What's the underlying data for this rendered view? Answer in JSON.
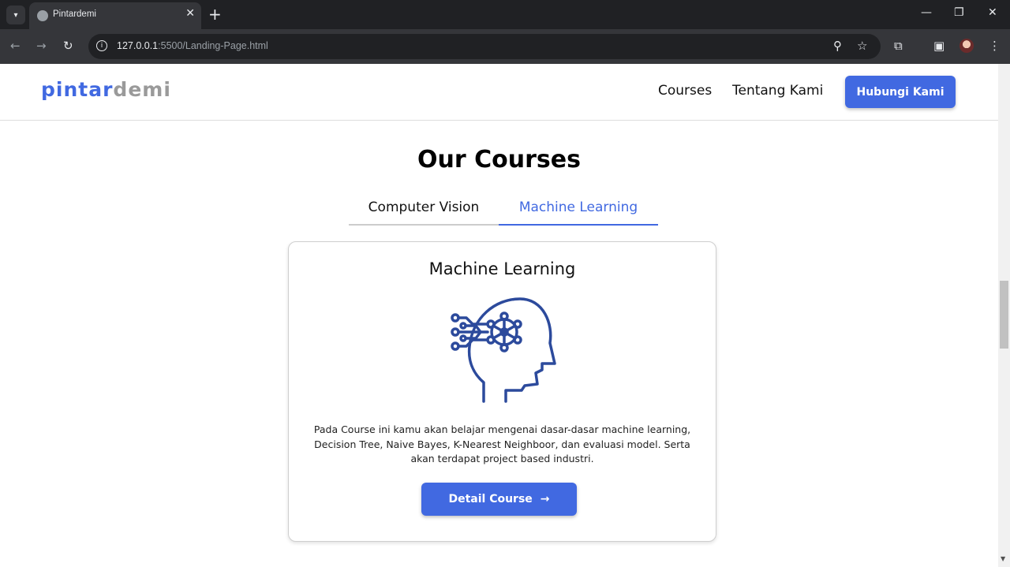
{
  "browser": {
    "tab_title": "Pintardemi",
    "url_host": "127.0.0.1",
    "url_rest": ":5500/Landing-Page.html"
  },
  "header": {
    "logo_part1": "pintar",
    "logo_part2": "demi",
    "nav": [
      "Courses",
      "Tentang Kami"
    ],
    "cta": "Hubungi Kami"
  },
  "courses": {
    "title": "Our Courses",
    "tabs": [
      "Computer Vision",
      "Machine Learning"
    ],
    "active_tab": "Machine Learning",
    "card": {
      "title": "Machine Learning",
      "icon": "ai-head-icon",
      "description": "Pada Course ini kamu akan belajar mengenai dasar-dasar machine learning, Decision Tree, Naive Bayes, K-Nearest Neighboor, dan evaluasi model. Serta akan terdapat project based industri.",
      "button": "Detail Course",
      "button_arrow": "→"
    }
  },
  "colors": {
    "accent": "#4169e1",
    "logo_gray": "#9a9a9a",
    "icon_stroke": "#2c4a9c"
  }
}
